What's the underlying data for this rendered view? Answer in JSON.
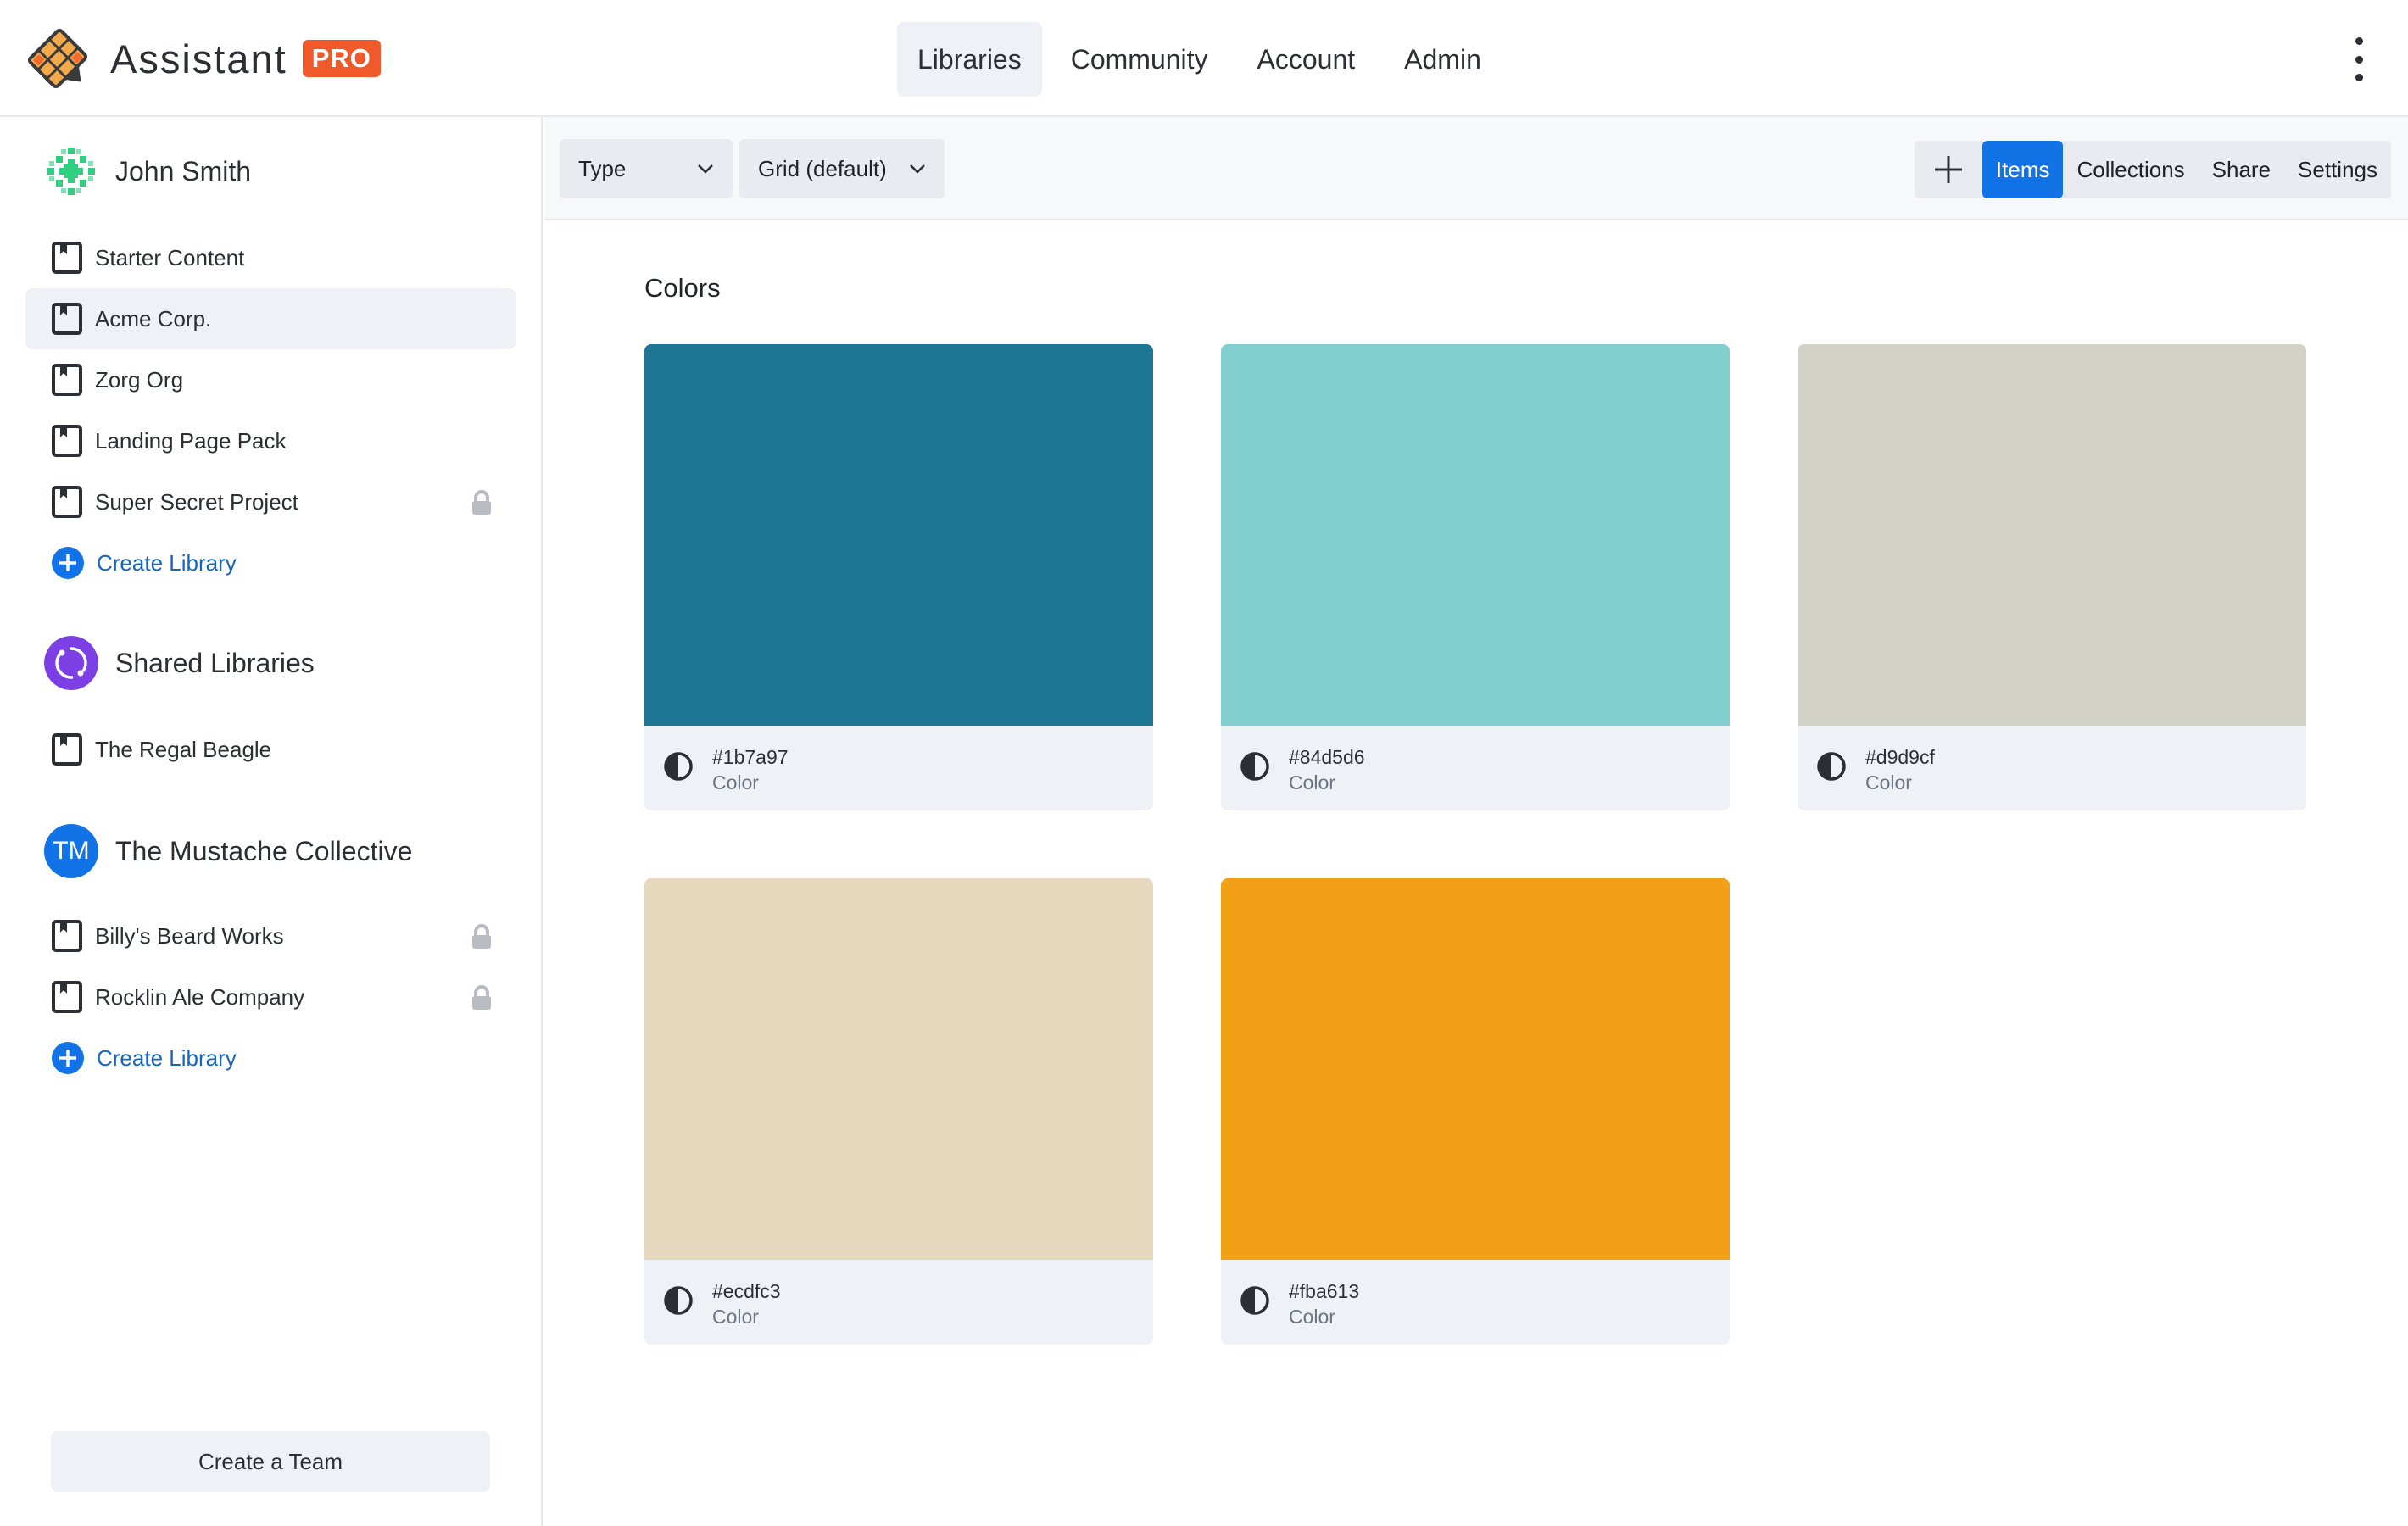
{
  "app": {
    "name": "Assistant",
    "badge": "PRO"
  },
  "nav": {
    "items": [
      "Libraries",
      "Community",
      "Account",
      "Admin"
    ],
    "active": "Libraries"
  },
  "sidebar": {
    "personal": {
      "name": "John Smith",
      "libraries": [
        {
          "label": "Starter Content",
          "locked": false
        },
        {
          "label": "Acme Corp.",
          "locked": false,
          "selected": true
        },
        {
          "label": "Zorg Org",
          "locked": false
        },
        {
          "label": "Landing Page Pack",
          "locked": false
        },
        {
          "label": "Super Secret Project",
          "locked": true
        }
      ],
      "create_label": "Create Library"
    },
    "shared": {
      "name": "Shared Libraries",
      "libraries": [
        {
          "label": "The Regal Beagle",
          "locked": false
        }
      ]
    },
    "team": {
      "initials": "TM",
      "name": "The Mustache Collective",
      "libraries": [
        {
          "label": "Billy's Beard Works",
          "locked": true
        },
        {
          "label": "Rocklin Ale Company",
          "locked": true
        }
      ],
      "create_label": "Create Library"
    },
    "create_team_label": "Create a Team"
  },
  "toolbar": {
    "type_filter": "Type",
    "view_mode": "Grid (default)",
    "tabs": [
      "Items",
      "Collections",
      "Share",
      "Settings"
    ],
    "active_tab": "Items"
  },
  "main": {
    "section_title": "Colors",
    "swatches": [
      {
        "hex": "#1b7a97",
        "type": "Color",
        "color": "#1d7794"
      },
      {
        "hex": "#84d5d6",
        "type": "Color",
        "color": "#82cfd1"
      },
      {
        "hex": "#d9d9cf",
        "type": "Color",
        "color": "#d3d2c9"
      },
      {
        "hex": "#ecdfc3",
        "type": "Color",
        "color": "#e5d8bd"
      },
      {
        "hex": "#fba613",
        "type": "Color",
        "color": "#f2a015"
      }
    ]
  },
  "colors": {
    "accent": "#1173e6",
    "link": "#1565c0",
    "badge": "#f0592a"
  }
}
